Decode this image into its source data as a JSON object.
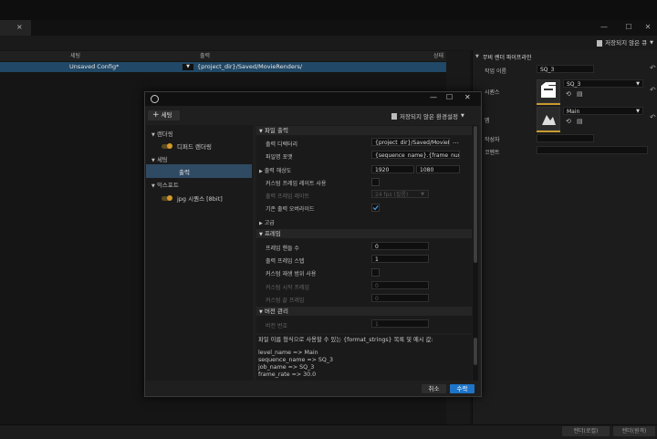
{
  "window": {
    "tab_close": "×"
  },
  "toolbar": {
    "unsaved_label": "저장되지 않은 큐"
  },
  "queue": {
    "columns": [
      "세팅",
      "출력",
      "상태"
    ],
    "row": {
      "config": "Unsaved Config*",
      "output": "{project_dir}/Saved/MovieRenders/",
      "status": ""
    }
  },
  "right_panel": {
    "title": "무비 렌더 파이프라인",
    "job_name_label": "작업 이름",
    "job_name_value": "SQ_3",
    "sequence_label": "시퀀스",
    "sequence_value": "SQ_3",
    "map_label": "맵",
    "map_value": "Main",
    "author_label": "작성자",
    "comment_label": "코멘트"
  },
  "bottom_bar": {
    "render_local": "렌더(로컬)",
    "render_remote": "렌더(원격)"
  },
  "dialog": {
    "add_setting": "세팅",
    "unsaved_config": "저장되지 않은 환경설정",
    "tree": {
      "rendering": "렌더링",
      "deferred": "디퍼드 렌더링",
      "settings": "세팅",
      "output": "출력",
      "export": "익스포트",
      "jpg": "jpg 시퀀스 [8bit]"
    },
    "sections": {
      "file_output": "파일 출력",
      "frames": "프레임",
      "versioning": "버전 관리"
    },
    "props": {
      "output_dir_label": "출력 디렉터리",
      "output_dir_value": "{project_dir}/Saved/MovieRe",
      "filename_label": "파일명 포맷",
      "filename_value": "{sequence_name}.{frame_number}",
      "resolution_label": "출력 해상도",
      "res_w": "1920",
      "res_h": "1080",
      "custom_rate_label": "커스텀 프레임 레이트 사용",
      "frame_rate_label": "출력 프레임 레이트",
      "frame_rate_value": "24 fps (필름)",
      "override_label": "기존 출력 오버라이드",
      "advanced_label": "고급",
      "handle_frames_label": "프레임 핸들 수",
      "handle_frames_value": "0",
      "output_step_label": "출력 프레임 스텝",
      "output_step_value": "1",
      "custom_range_label": "커스텀 재생 범위 사용",
      "custom_start_label": "커스텀 시작 프레임",
      "custom_start_value": "0",
      "custom_end_label": "커스텀 끝 프레임",
      "custom_end_value": "0",
      "version_label": "버전 번호",
      "version_value": "1"
    },
    "help": {
      "intro": "파일 이름 형식으로 사용할 수 있는 {format_strings} 목록 및 예시 값:",
      "lines": [
        "level_name => Main",
        "sequence_name => SQ_3",
        "job_name => SQ_3",
        "frame_rate => 30.0"
      ]
    },
    "cancel": "취소",
    "accept": "수락"
  },
  "colors": {
    "accent_blue": "#1e74c8",
    "selection": "#214866",
    "tree_selected": "#2f4a63"
  }
}
